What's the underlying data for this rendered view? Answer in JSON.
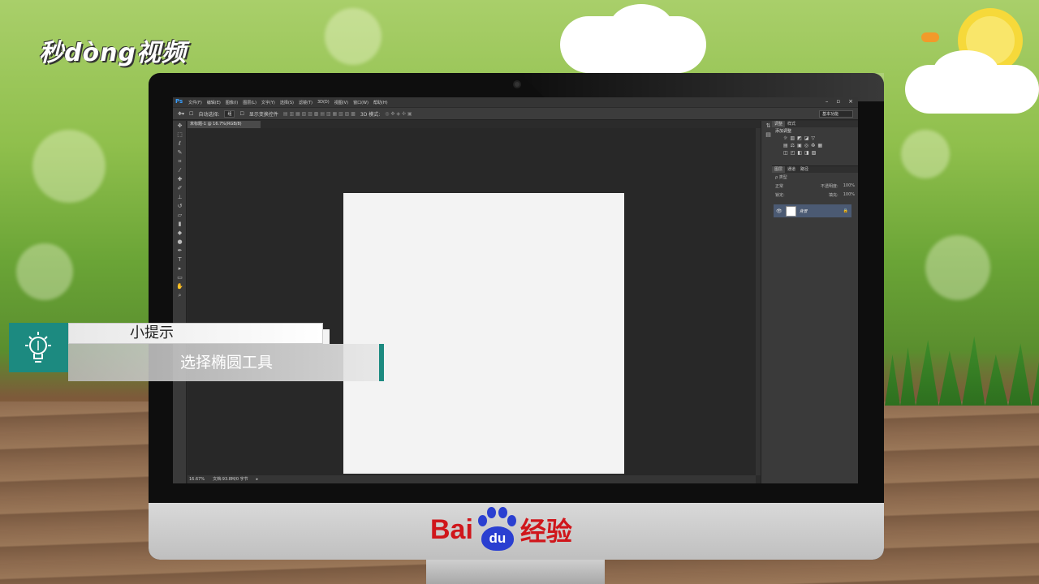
{
  "branding": {
    "logo_text": "秒dòng视频",
    "baidu_left": "Bai",
    "baidu_paw": "du",
    "baidu_right": "经验"
  },
  "photoshop": {
    "app_icon": "Ps",
    "menu": [
      "文件(F)",
      "编辑(E)",
      "图像(I)",
      "图层(L)",
      "文字(Y)",
      "选择(S)",
      "滤镜(T)",
      "3D(D)",
      "视图(V)",
      "窗口(W)",
      "帮助(H)"
    ],
    "window_controls": [
      "–",
      "▫",
      "×"
    ],
    "options": {
      "auto_select_label": "自动选择:",
      "auto_select_value": "组",
      "transform_label": "显示变换控件",
      "mode_3d": "3D 模式:",
      "workspace": "基本功能"
    },
    "document_tab": "未标题-1 @ 16.7%(RGB/8)",
    "status": {
      "zoom": "16.67%",
      "doc_info": "文档:93.8M/0 字节"
    },
    "panels": {
      "top_tabs": [
        "调整",
        "样式"
      ],
      "adjust_title": "添加调整",
      "adjust_row1": [
        "☼",
        "▥",
        "◩",
        "◪",
        "▽"
      ],
      "adjust_row2": [
        "▤",
        "⚖",
        "▣",
        "◎",
        "♻",
        "▦"
      ],
      "adjust_row3": [
        "◫",
        "◰",
        "◧",
        "◨",
        "▧"
      ],
      "layer_tabs": [
        "图层",
        "通道",
        "路径"
      ],
      "kind_label": "ρ 类型",
      "blend_mode": "正常",
      "opacity_label": "不透明度:",
      "opacity_value": "100%",
      "lock_label": "锁定:",
      "fill_label": "填充:",
      "fill_value": "100%",
      "layer_name": "背景",
      "lock_icon": "🔒"
    }
  },
  "tip": {
    "title": "小提示",
    "text": "选择椭圆工具"
  },
  "colors": {
    "accent_teal": "#1c8a80",
    "baidu_red": "#d0161b",
    "baidu_blue": "#2a3fd1"
  }
}
